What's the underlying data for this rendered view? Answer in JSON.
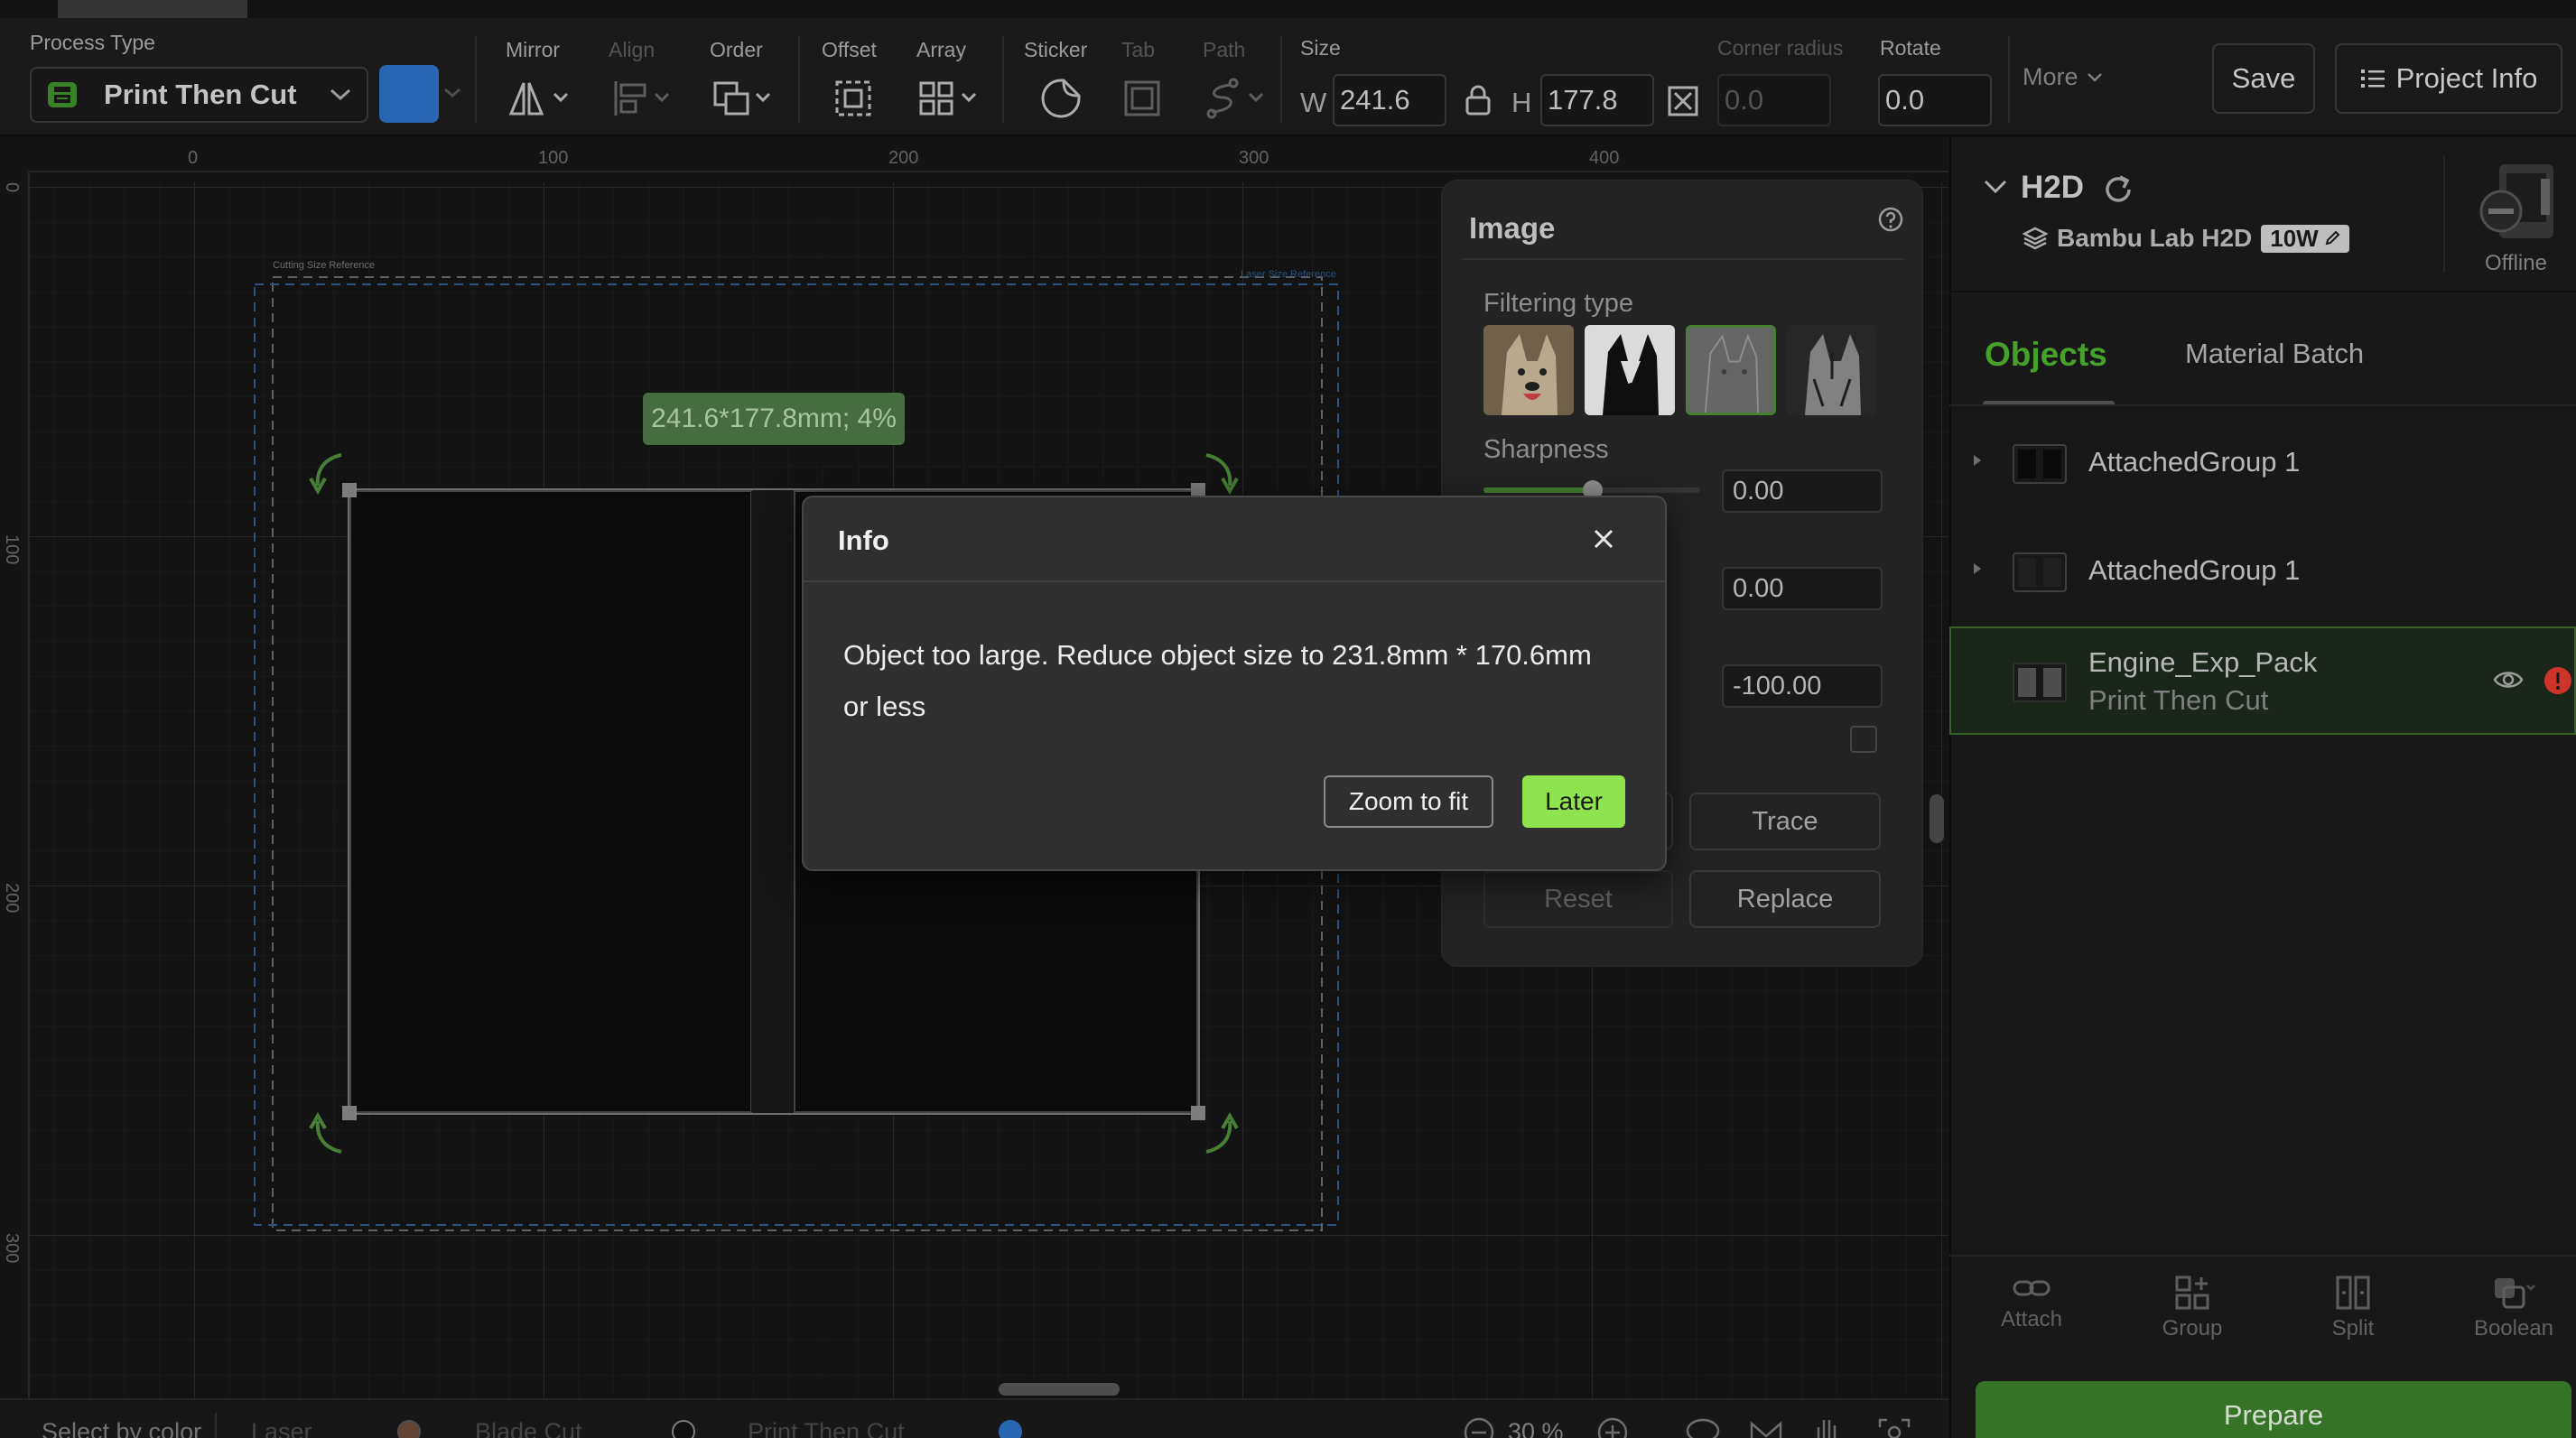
{
  "toolbar": {
    "process_type_label": "Process Type",
    "process_type_value": "Print Then Cut",
    "mirror_label": "Mirror",
    "align_label": "Align",
    "order_label": "Order",
    "offset_label": "Offset",
    "array_label": "Array",
    "sticker_label": "Sticker",
    "tab_label": "Tab",
    "path_label": "Path",
    "size_label": "Size",
    "w_label": "W",
    "w_value": "241.6",
    "h_label": "H",
    "h_value": "177.8",
    "corner_radius_label": "Corner radius",
    "corner_radius_value": "0.0",
    "rotate_label": "Rotate",
    "rotate_value": "0.0",
    "more_label": "More",
    "save_label": "Save",
    "project_info_label": "Project Info",
    "color_swatch": "#2d6fc4"
  },
  "canvas": {
    "ruler_top": [
      "0",
      "100",
      "200",
      "300",
      "400"
    ],
    "ruler_left": [
      "0",
      "100",
      "200",
      "300"
    ],
    "cutting_ref_label": "Cutting Size Reference",
    "laser_ref_label": "Laser Size Reference",
    "size_tooltip": "241.6*177.8mm; 4%"
  },
  "image_panel": {
    "title": "Image",
    "filtering_type_label": "Filtering type",
    "sharpness_label": "Sharpness",
    "value1": "0.00",
    "value2": "0.00",
    "value3": "-100.00",
    "trace_label": "Trace",
    "reset_label": "Reset",
    "replace_label": "Replace"
  },
  "dialog": {
    "title": "Info",
    "message_line1": "Object too large. Reduce object size to 231.8mm * 170.6mm",
    "message_line2": "or less",
    "zoom_button": "Zoom to fit",
    "later_button": "Later"
  },
  "right_panel": {
    "printer_short": "H2D",
    "printer_name": "Bambu Lab H2D",
    "laser_badge": "10W",
    "status": "Offline",
    "tab_objects": "Objects",
    "tab_material": "Material Batch",
    "objects": [
      {
        "name": "AttachedGroup 1",
        "sub": ""
      },
      {
        "name": "AttachedGroup 1",
        "sub": ""
      },
      {
        "name": "Engine_Exp_Pack",
        "sub": "Print Then Cut"
      }
    ],
    "actions": {
      "attach": "Attach",
      "group": "Group",
      "split": "Split",
      "boolean": "Boolean"
    },
    "prepare_label": "Prepare"
  },
  "bottom_bar": {
    "select_by_color": "Select by color",
    "laser": "Laser",
    "blade_cut": "Blade Cut",
    "print_then_cut": "Print Then Cut",
    "zoom": "30 %"
  },
  "colors": {
    "accent_green": "#4caf2f",
    "later_button": "#8fe34f",
    "prepare": "#3a7d2a",
    "error": "#e0392d"
  }
}
